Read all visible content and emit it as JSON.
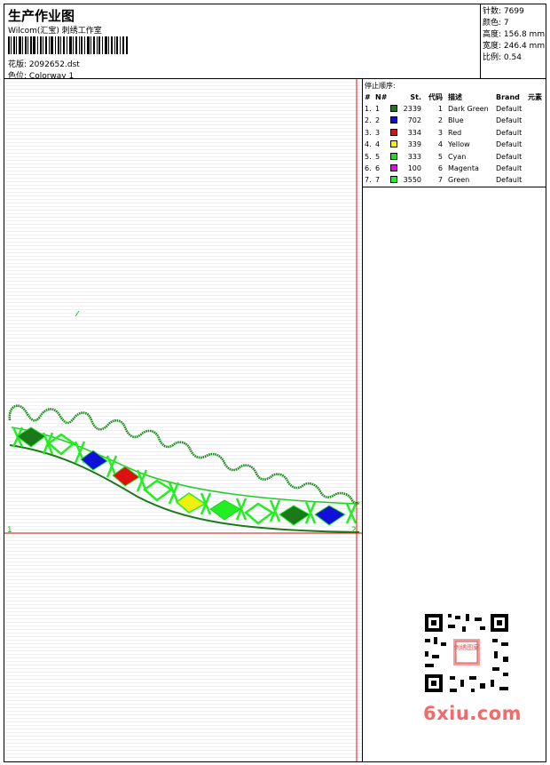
{
  "header": {
    "title": "生产作业图",
    "subtitle": "Wilcom(汇宝) 刺绣工作室",
    "pattern_label": "花版:",
    "pattern_value": "2092652.dst",
    "colorway_label": "色位:",
    "colorway_value": "Colorway 1"
  },
  "stats": {
    "stitches_label": "针数:",
    "stitches_value": "7699",
    "colors_label": "颜色:",
    "colors_value": "7",
    "height_label": "高度:",
    "height_value": "156.8 mm",
    "width_label": "宽度:",
    "width_value": "246.4 mm",
    "scale_label": "比例:",
    "scale_value": "0.54"
  },
  "design": {
    "origin_marker": "1",
    "end_marker": "2"
  },
  "stop_sequence": {
    "title": "停止顺序:",
    "columns": {
      "num": "#",
      "no": "N#",
      "stitches": "St.",
      "code": "代码",
      "description": "描述",
      "brand": "Brand",
      "element": "元素"
    },
    "rows": [
      {
        "num": "1.",
        "no": "1",
        "stitches": "2339",
        "code": "1",
        "description": "Dark Green",
        "brand": "Default",
        "color": "#1a7a1a"
      },
      {
        "num": "2.",
        "no": "2",
        "stitches": "702",
        "code": "2",
        "description": "Blue",
        "brand": "Default",
        "color": "#1010d8"
      },
      {
        "num": "3.",
        "no": "3",
        "stitches": "334",
        "code": "3",
        "description": "Red",
        "brand": "Default",
        "color": "#e01010"
      },
      {
        "num": "4.",
        "no": "4",
        "stitches": "339",
        "code": "4",
        "description": "Yellow",
        "brand": "Default",
        "color": "#f0f010"
      },
      {
        "num": "5.",
        "no": "5",
        "stitches": "333",
        "code": "5",
        "description": "Cyan",
        "brand": "Default",
        "color": "#22dd22"
      },
      {
        "num": "6.",
        "no": "6",
        "stitches": "100",
        "code": "6",
        "description": "Magenta",
        "brand": "Default",
        "color": "#e010e0"
      },
      {
        "num": "7.",
        "no": "7",
        "stitches": "3550",
        "code": "7",
        "description": "Green",
        "brand": "Default",
        "color": "#22ee22"
      }
    ]
  },
  "watermark": {
    "qr_center_text": "刺绣图案",
    "site_text": "6xiu.com"
  }
}
